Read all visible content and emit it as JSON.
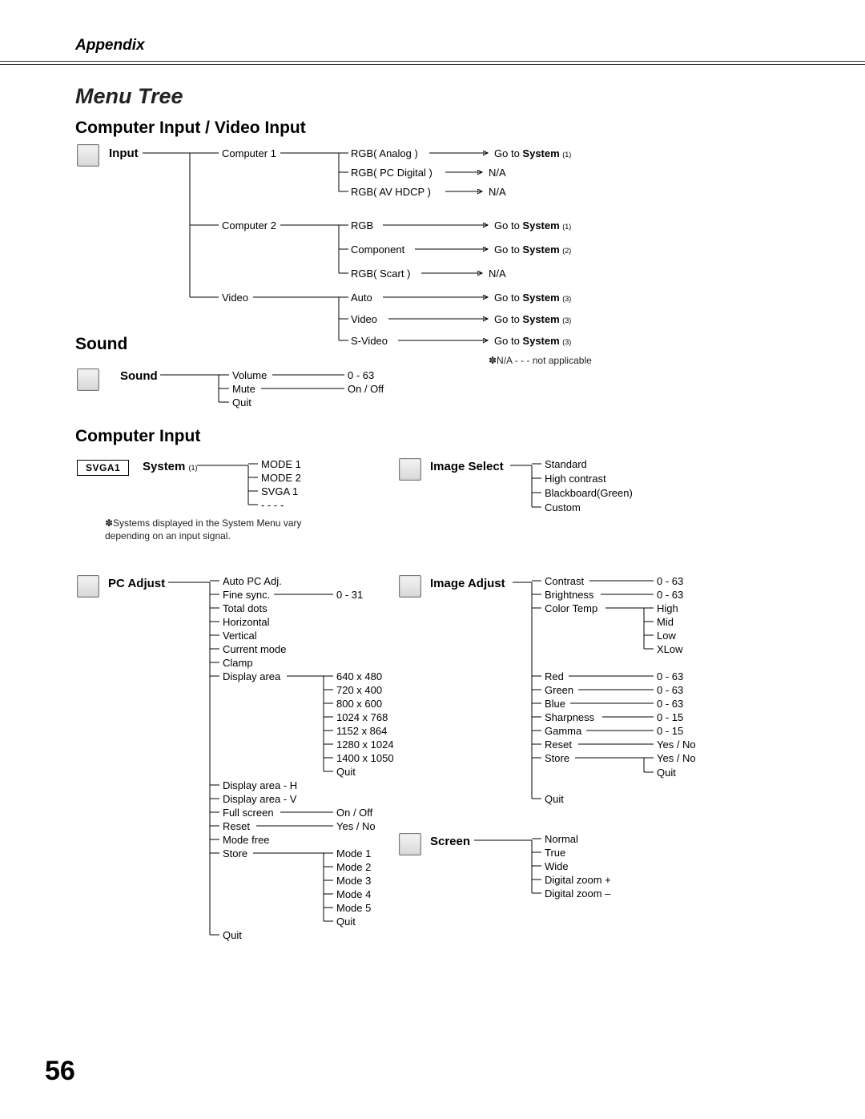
{
  "header": "Appendix",
  "title": "Menu Tree",
  "page_number": "56",
  "sections": {
    "cv_input": "Computer Input / Video Input",
    "sound": "Sound",
    "comp_input": "Computer Input"
  },
  "input": {
    "label": "Input",
    "c1": "Computer 1",
    "c1_rgb_analog": "RGB( Analog )",
    "c1_rgb_pcdig": "RGB( PC Digital )",
    "c1_rgb_avhdcp": "RGB( AV HDCP )",
    "c2": "Computer 2",
    "c2_rgb": "RGB",
    "c2_component": "Component",
    "c2_rgb_scart": "RGB( Scart )",
    "video": "Video",
    "v_auto": "Auto",
    "v_video": "Video",
    "v_svideo": "S-Video",
    "goto_sys1_a": "Go to ",
    "goto_sys1_b": "System",
    "goto_sys1_s": "(1)",
    "goto_sys2_s": "(2)",
    "goto_sys3_s": "(3)",
    "na": "N/A",
    "note_na": "✽N/A - - - not applicable"
  },
  "sound": {
    "label": "Sound",
    "volume": "Volume",
    "volume_range": "0 - 63",
    "mute": "Mute",
    "mute_range": "On / Off",
    "quit": "Quit"
  },
  "system": {
    "label_a": "System",
    "label_s": "(1)",
    "badge": "SVGA1",
    "m1": "MODE 1",
    "m2": "MODE 2",
    "svga1": "SVGA 1",
    "dash": "- - - -",
    "footnote": "✽Systems displayed in the System Menu vary depending on an input signal."
  },
  "image_select": {
    "label": "Image Select",
    "standard": "Standard",
    "high": "High contrast",
    "blackboard": "Blackboard(Green)",
    "custom": "Custom"
  },
  "pc_adjust": {
    "label": "PC Adjust",
    "auto": "Auto PC Adj.",
    "fine": "Fine sync.",
    "fine_range": "0 - 31",
    "total": "Total dots",
    "horiz": "Horizontal",
    "vert": "Vertical",
    "curmode": "Current mode",
    "clamp": "Clamp",
    "disp_area": "Display area",
    "da_640": "640 x 480",
    "da_720": "720 x 400",
    "da_800": "800 x 600",
    "da_1024": "1024 x 768",
    "da_1152": "1152 x 864",
    "da_1280": "1280 x 1024",
    "da_1400": "1400 x 1050",
    "da_quit": "Quit",
    "disp_h": "Display area - H",
    "disp_v": "Display area - V",
    "full": "Full screen",
    "full_range": "On / Off",
    "reset": "Reset",
    "reset_range": "Yes / No",
    "modefree": "Mode free",
    "store": "Store",
    "sm1": "Mode 1",
    "sm2": "Mode 2",
    "sm3": "Mode 3",
    "sm4": "Mode 4",
    "sm5": "Mode 5",
    "squit": "Quit",
    "quit": "Quit"
  },
  "image_adjust": {
    "label": "Image Adjust",
    "contrast": "Contrast",
    "contrast_r": "0 - 63",
    "brightness": "Brightness",
    "brightness_r": "0 - 63",
    "colortemp": "Color Temp",
    "ct_high": "High",
    "ct_mid": "Mid",
    "ct_low": "Low",
    "ct_xlow": "XLow",
    "red": "Red",
    "red_r": "0 - 63",
    "green": "Green",
    "green_r": "0 - 63",
    "blue": "Blue",
    "blue_r": "0 - 63",
    "sharp": "Sharpness",
    "sharp_r": "0 - 15",
    "gamma": "Gamma",
    "gamma_r": "0 - 15",
    "reset": "Reset",
    "reset_r": "Yes / No",
    "store": "Store",
    "store_r": "Yes / No",
    "store_quit": "Quit",
    "quit": "Quit"
  },
  "screen": {
    "label": "Screen",
    "normal": "Normal",
    "true": "True",
    "wide": "Wide",
    "dzp": "Digital zoom +",
    "dzm": "Digital zoom –"
  }
}
